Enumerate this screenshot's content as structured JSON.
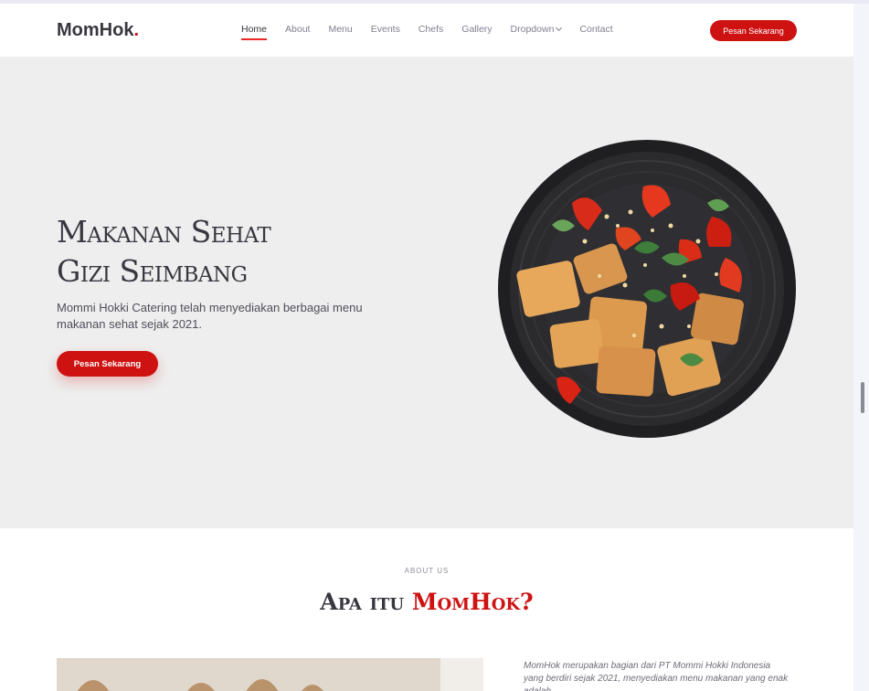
{
  "header": {
    "logo_text": "MomHok",
    "logo_dot": ".",
    "nav": [
      {
        "label": "Home",
        "active": true
      },
      {
        "label": "About"
      },
      {
        "label": "Menu"
      },
      {
        "label": "Events"
      },
      {
        "label": "Chefs"
      },
      {
        "label": "Gallery"
      },
      {
        "label": "Dropdown"
      },
      {
        "label": "Contact"
      }
    ],
    "cta_label": "Pesan Sekarang"
  },
  "hero": {
    "title_line1": "Makanan Sehat",
    "title_line2": "Gizi Seimbang",
    "description": "Mommi Hokki Catering telah menyediakan berbagai menu makanan sehat sejak 2021.",
    "cta_label": "Pesan Sekarang"
  },
  "about": {
    "section_label": "ABOUT US",
    "title_prefix": "Apa itu ",
    "title_accent": "MomHok?",
    "text": "MomHok merupakan bagian dari PT Mommi Hokki Indonesia yang berdiri sejak 2021, menyediakan menu makanan yang enak adalah"
  },
  "colors": {
    "accent": "#ce1212",
    "hero_bg": "#eeeeee",
    "text_dark": "#37373f"
  }
}
